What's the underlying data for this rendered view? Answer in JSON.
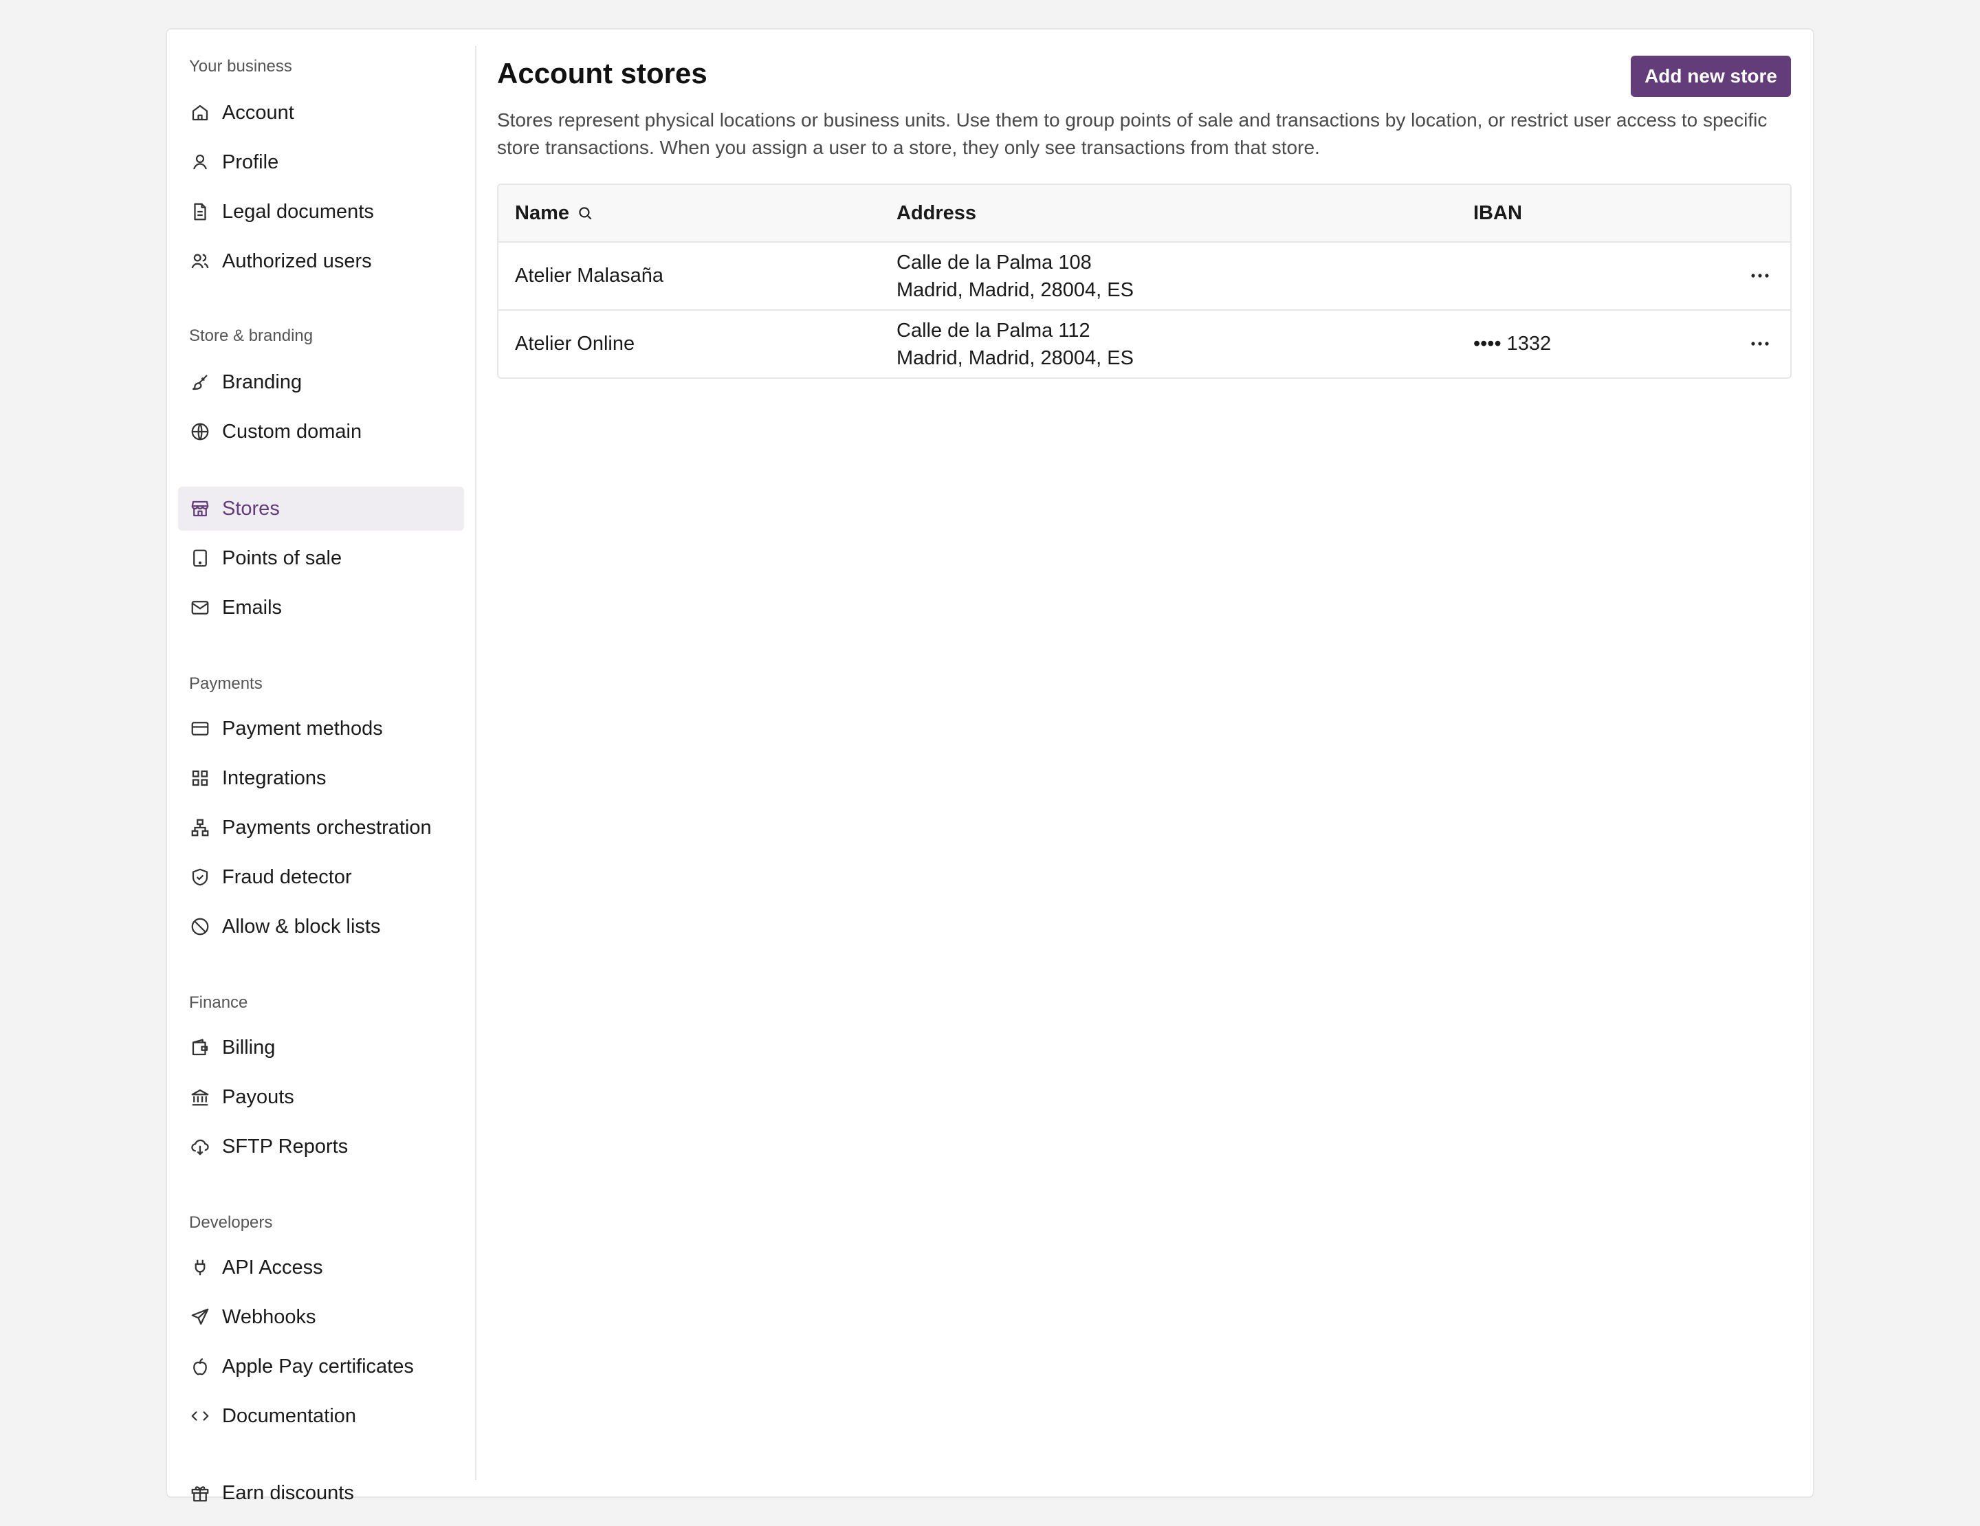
{
  "sidebar": {
    "sections": [
      {
        "label": "Your business",
        "items": [
          {
            "label": "Account",
            "icon": "home-icon"
          },
          {
            "label": "Profile",
            "icon": "user-icon"
          },
          {
            "label": "Legal documents",
            "icon": "document-icon"
          },
          {
            "label": "Authorized users",
            "icon": "users-icon"
          }
        ]
      },
      {
        "label": "Store & branding",
        "items": [
          {
            "label": "Branding",
            "icon": "brush-icon"
          },
          {
            "label": "Custom domain",
            "icon": "globe-icon"
          },
          {
            "label": "Stores",
            "icon": "store-icon",
            "active": true
          },
          {
            "label": "Points of sale",
            "icon": "tablet-icon"
          },
          {
            "label": "Emails",
            "icon": "mail-icon"
          }
        ]
      },
      {
        "label": "Payments",
        "items": [
          {
            "label": "Payment methods",
            "icon": "credit-card-icon"
          },
          {
            "label": "Integrations",
            "icon": "grid-icon"
          },
          {
            "label": "Payments orchestration",
            "icon": "network-icon"
          },
          {
            "label": "Fraud detector",
            "icon": "shield-check-icon"
          },
          {
            "label": "Allow & block lists",
            "icon": "ban-icon"
          }
        ]
      },
      {
        "label": "Finance",
        "items": [
          {
            "label": "Billing",
            "icon": "wallet-icon"
          },
          {
            "label": "Payouts",
            "icon": "bank-icon"
          },
          {
            "label": "SFTP Reports",
            "icon": "cloud-download-icon"
          }
        ]
      },
      {
        "label": "Developers",
        "items": [
          {
            "label": "API Access",
            "icon": "plug-icon"
          },
          {
            "label": "Webhooks",
            "icon": "send-icon"
          },
          {
            "label": "Apple Pay certificates",
            "icon": "apple-icon"
          },
          {
            "label": "Documentation",
            "icon": "code-icon"
          }
        ]
      }
    ],
    "footer_item": {
      "label": "Earn discounts",
      "icon": "gift-icon"
    }
  },
  "main": {
    "title": "Account stores",
    "add_button_label": "Add new store",
    "description": "Stores represent physical locations or business units. Use them to group points of sale and transactions by location, or restrict user access to specific store transactions. When you assign a user to a store, they only see transactions from that store.",
    "table": {
      "columns": [
        "Name",
        "Address",
        "IBAN"
      ],
      "rows": [
        {
          "name": "Atelier Malasaña",
          "address_line1": "Calle de la Palma 108",
          "address_line2": "Madrid, Madrid, 28004, ES",
          "iban": ""
        },
        {
          "name": "Atelier Online",
          "address_line1": "Calle de la Palma 112",
          "address_line2": "Madrid, Madrid, 28004, ES",
          "iban": "•••• 1332"
        }
      ]
    }
  },
  "colors": {
    "accent": "#633c7a",
    "active_bg": "#efedf1"
  }
}
